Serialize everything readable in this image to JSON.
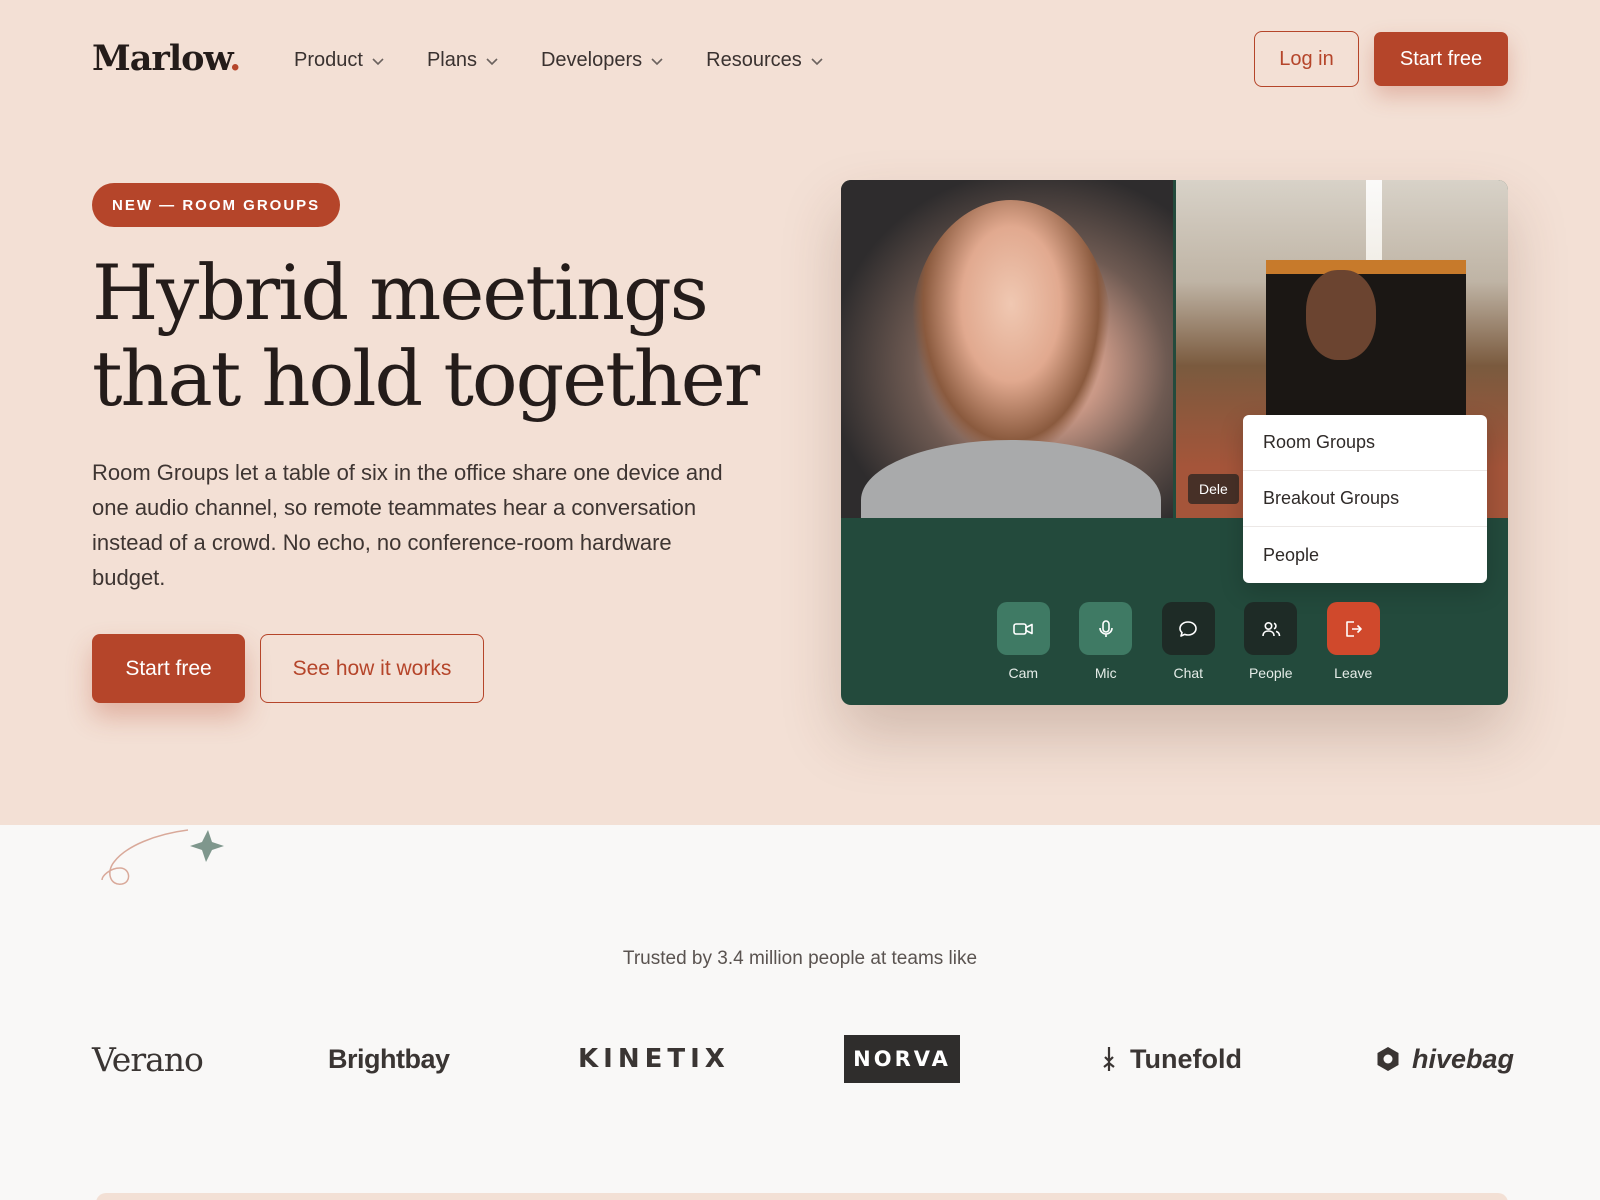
{
  "brand": {
    "name": "Marlow",
    "dot": "."
  },
  "nav": {
    "items": [
      {
        "label": "Product"
      },
      {
        "label": "Plans"
      },
      {
        "label": "Developers"
      },
      {
        "label": "Resources"
      }
    ],
    "login_label": "Log in",
    "start_label": "Start free"
  },
  "hero": {
    "badge": "NEW — ROOM GROUPS",
    "headline_line1": "Hybrid meetings",
    "headline_line2": "that hold together",
    "subtext": "Room Groups let a table of six in the office share one device and one audio channel, so remote teammates hear a conversation instead of a crowd. No echo, no conference-room hardware budget.",
    "primary_cta": "Start free",
    "secondary_cta": "See how it works"
  },
  "meeting": {
    "participant_tag": "Dele",
    "menu": [
      "Room Groups",
      "Breakout Groups",
      "People"
    ],
    "controls": [
      {
        "label": "Cam",
        "icon": "camera-icon"
      },
      {
        "label": "Mic",
        "icon": "mic-icon"
      },
      {
        "label": "Chat",
        "icon": "chat-icon"
      },
      {
        "label": "People",
        "icon": "people-icon"
      },
      {
        "label": "Leave",
        "icon": "leave-icon"
      }
    ]
  },
  "trust": {
    "text": "Trusted by 3.4 million people at teams like",
    "logos": [
      "Verano",
      "Brightbay",
      "KINETIX",
      "NORVA",
      "Tunefold",
      "hivebag"
    ]
  },
  "colors": {
    "accent": "#b5452a",
    "hero_bg": "#f3e0d5",
    "card_bg": "#234a3c",
    "leave_red": "#d0492c"
  }
}
